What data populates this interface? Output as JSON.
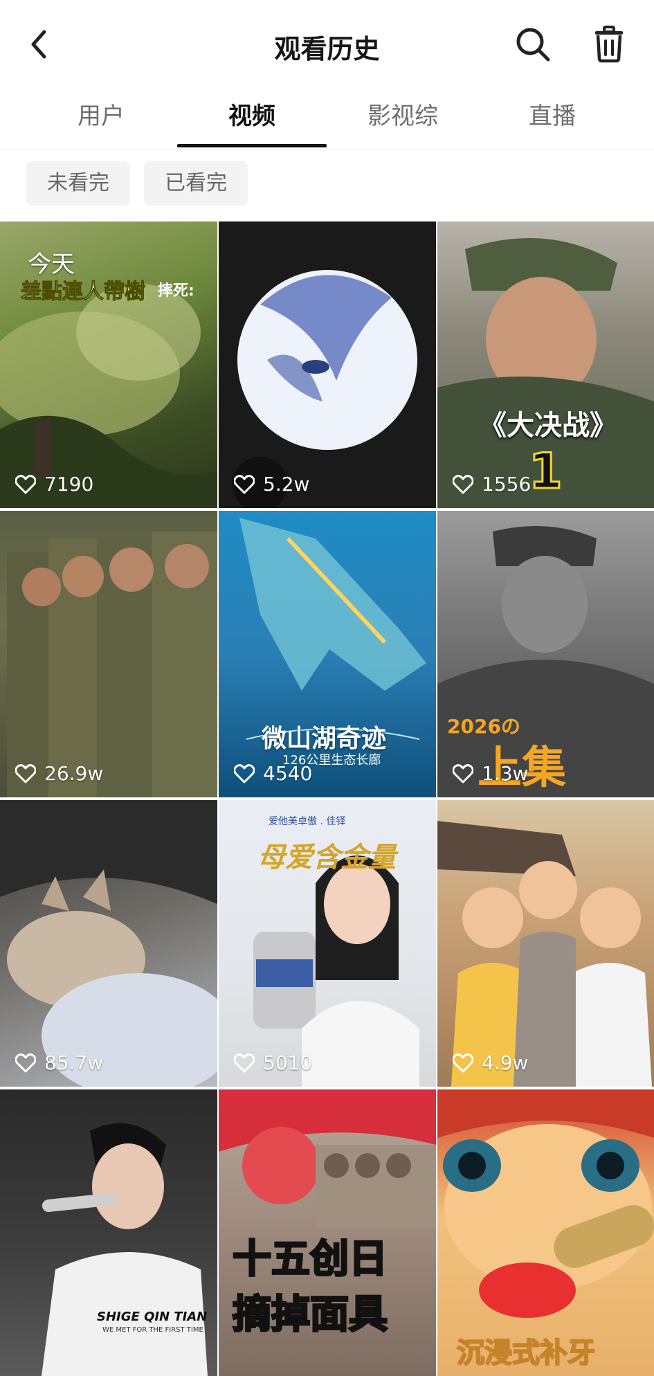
{
  "header": {
    "title": "观看历史",
    "back_icon": "chevron-left-icon",
    "search_icon": "search-icon",
    "trash_icon": "trash-icon"
  },
  "tabs": [
    {
      "label": "用户",
      "active": false
    },
    {
      "label": "视频",
      "active": true
    },
    {
      "label": "影视综",
      "active": false
    },
    {
      "label": "直播",
      "active": false
    }
  ],
  "filters": [
    {
      "label": "未看完"
    },
    {
      "label": "已看完"
    }
  ],
  "today_label": "今天",
  "videos": [
    {
      "likes": "7190",
      "caption": "差點連人帶樹",
      "caption2": "摔死:"
    },
    {
      "likes": "5.2w",
      "caption": ""
    },
    {
      "likes": "1556",
      "caption": "《大决战》",
      "caption2": "1"
    },
    {
      "likes": "26.9w",
      "caption": ""
    },
    {
      "likes": "4540",
      "caption": "微山湖奇迹",
      "caption2": "126公里生态长廊"
    },
    {
      "likes": "1.3w",
      "caption": "2026の",
      "caption2": "上集"
    },
    {
      "likes": "85.7w",
      "caption": ""
    },
    {
      "likes": "5010",
      "caption": "母爱含金量",
      "caption2": "爱他美卓傲 . 佳铎"
    },
    {
      "likes": "4.9w",
      "caption": ""
    },
    {
      "likes": "",
      "caption": "SHIGE QIN TIAN",
      "caption2": "WE MET FOR THE FIRST TIME"
    },
    {
      "likes": "",
      "caption": "十五创日",
      "caption2": "摘掉面具"
    },
    {
      "likes": "",
      "caption": "沉浸式补牙"
    }
  ]
}
